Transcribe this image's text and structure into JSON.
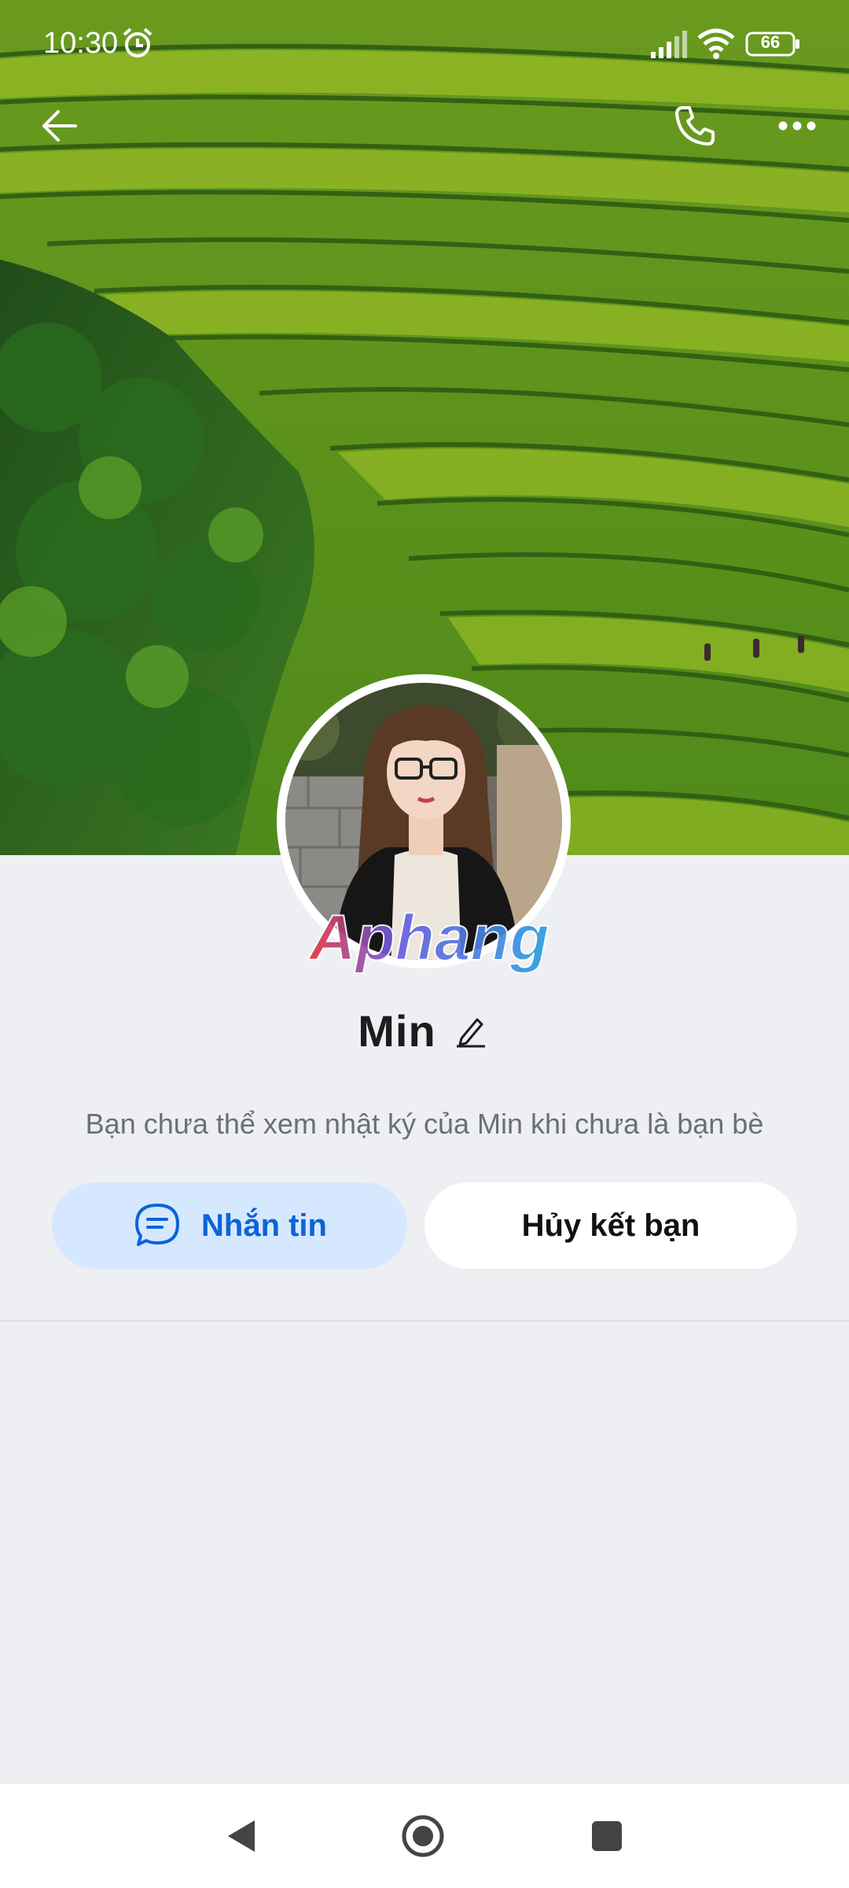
{
  "status_bar": {
    "time": "10:30",
    "battery_level": "66",
    "icons": [
      "alarm-icon",
      "signal-icon",
      "wifi-icon",
      "battery-icon"
    ]
  },
  "header": {
    "icons": [
      "back-arrow-icon",
      "phone-icon",
      "more-icon"
    ]
  },
  "profile": {
    "name": "Min",
    "watermark": "Aphang",
    "diary_notice": "Bạn chưa thể xem nhật ký của Min khi chưa là bạn bè"
  },
  "actions": {
    "message_label": "Nhắn tin",
    "unfriend_label": "Hủy kết bạn"
  },
  "colors": {
    "background": "#eeeff2",
    "accent": "#0b64d8",
    "message_button_bg": "#d6e8ff"
  },
  "navigation_bar": {
    "icons": [
      "nav-back-icon",
      "nav-home-icon",
      "nav-recent-icon"
    ]
  }
}
